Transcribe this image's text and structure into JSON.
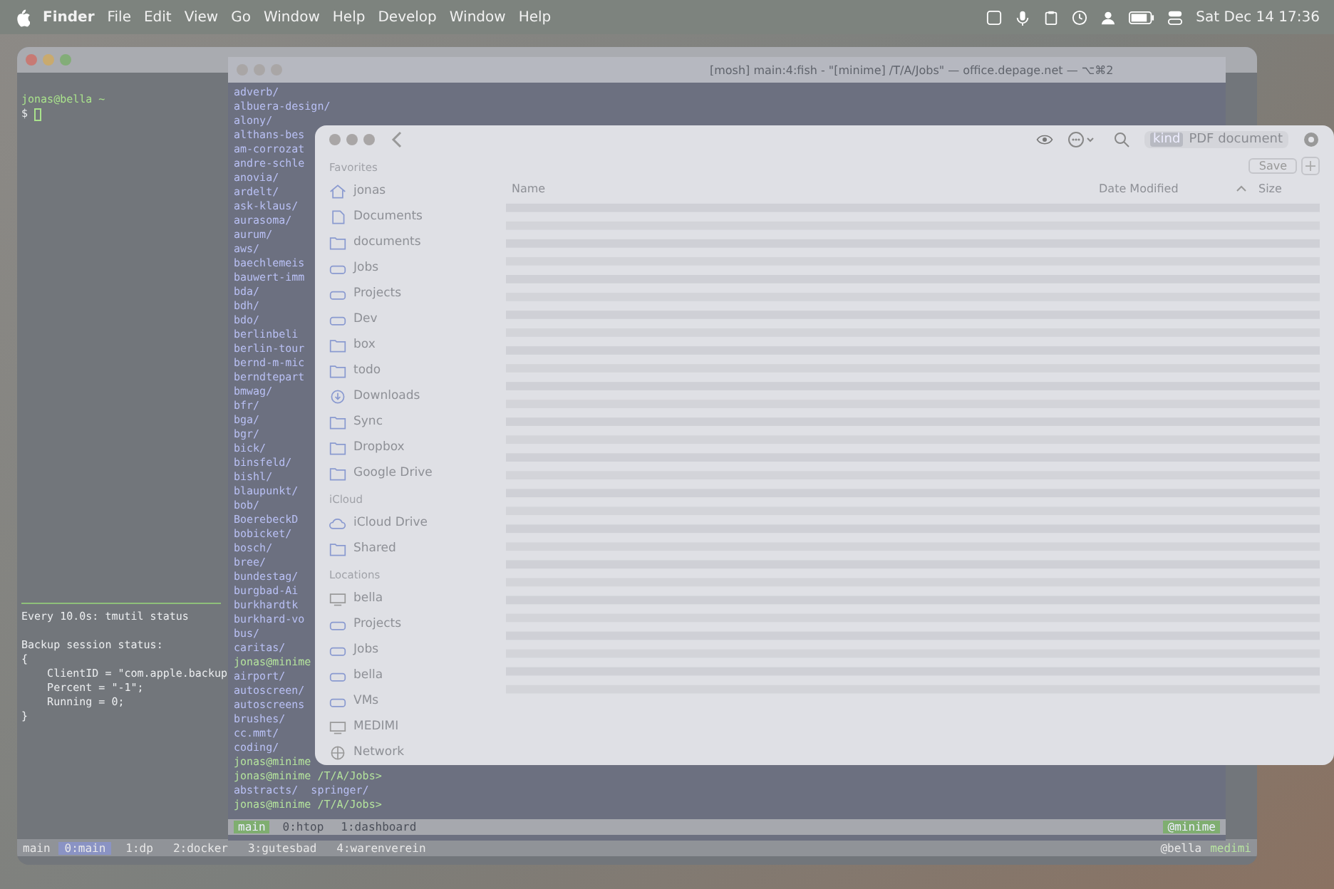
{
  "menu_bar": {
    "app": "Finder",
    "menus": [
      "File",
      "Edit",
      "View",
      "Go",
      "Window",
      "Help",
      "Develop",
      "Window",
      "Help"
    ],
    "clock": "Sat Dec 14 17:36"
  },
  "terminal_left": {
    "prompt": "jonas@bella ~",
    "cursor_line": "$",
    "watch_header": "Every 10.0s: tmutil status",
    "output": [
      "Backup session status:",
      "{",
      "    ClientID = \"com.apple.backup",
      "    Percent = \"-1\";",
      "    Running = 0;",
      "}"
    ],
    "tmux": {
      "session": "main",
      "windows": [
        {
          "label": "0:main",
          "selected": true
        },
        {
          "label": "1:dp",
          "selected": false
        },
        {
          "label": "2:docker",
          "selected": false
        },
        {
          "label": "3:gutesbad",
          "selected": false
        },
        {
          "label": "4:warenverein",
          "selected": false
        }
      ],
      "status": [
        "@bella",
        "medimi"
      ]
    }
  },
  "terminal_mid": {
    "title": "[mosh] main:4:fish - \"[minime] /T/A/Jobs\" — office.depage.net — ⌥⌘2",
    "lines": [
      {
        "kind": "dir",
        "text": "adverb/"
      },
      {
        "kind": "dir",
        "text": "albuera-design/"
      },
      {
        "kind": "dir",
        "text": "alony/"
      },
      {
        "kind": "dir",
        "text": "althans-bes"
      },
      {
        "kind": "dir",
        "text": "am-corrozat"
      },
      {
        "kind": "dir",
        "text": "andre-schle"
      },
      {
        "kind": "dir",
        "text": "anovia/"
      },
      {
        "kind": "dir",
        "text": "ardelt/"
      },
      {
        "kind": "dir",
        "text": "ask-klaus/"
      },
      {
        "kind": "dir",
        "text": "aurasoma/"
      },
      {
        "kind": "dir",
        "text": "aurum/"
      },
      {
        "kind": "dir",
        "text": "aws/"
      },
      {
        "kind": "dir",
        "text": "baechlemeis"
      },
      {
        "kind": "dir",
        "text": "bauwert-imm"
      },
      {
        "kind": "dir",
        "text": "bda/"
      },
      {
        "kind": "dir",
        "text": "bdh/"
      },
      {
        "kind": "dir",
        "text": "bdo/"
      },
      {
        "kind": "dir",
        "text": "berlinbeli"
      },
      {
        "kind": "dir",
        "text": "berlin-tour"
      },
      {
        "kind": "dir",
        "text": "bernd-m-mic"
      },
      {
        "kind": "dir",
        "text": "berndtepart"
      },
      {
        "kind": "dir",
        "text": "bmwag/"
      },
      {
        "kind": "dir",
        "text": "bfr/"
      },
      {
        "kind": "dir",
        "text": "bga/"
      },
      {
        "kind": "dir",
        "text": "bgr/"
      },
      {
        "kind": "dir",
        "text": "bick/"
      },
      {
        "kind": "dir",
        "text": "binsfeld/"
      },
      {
        "kind": "dir",
        "text": "bishl/"
      },
      {
        "kind": "dir",
        "text": "blaupunkt/"
      },
      {
        "kind": "dir",
        "text": "bob/"
      },
      {
        "kind": "dir",
        "text": "BoerebeckD"
      },
      {
        "kind": "dir",
        "text": "bobicket/"
      },
      {
        "kind": "dir",
        "text": "bosch/"
      },
      {
        "kind": "dir",
        "text": "bree/"
      },
      {
        "kind": "dir",
        "text": "bundestag/"
      },
      {
        "kind": "dir",
        "text": "burgbad-Ai"
      },
      {
        "kind": "dir",
        "text": "burkhardtk"
      },
      {
        "kind": "dir",
        "text": "burkhard-vo"
      },
      {
        "kind": "dir",
        "text": "bus/"
      },
      {
        "kind": "dir",
        "text": "caritas/"
      },
      {
        "kind": "prompt",
        "text": "jonas@minime"
      },
      {
        "kind": "dir",
        "text": "airport/"
      },
      {
        "kind": "dir",
        "text": "autoscreen/"
      },
      {
        "kind": "dir",
        "text": "autoscreens"
      },
      {
        "kind": "dir",
        "text": "brushes/"
      },
      {
        "kind": "dir",
        "text": "cc.mmt/"
      },
      {
        "kind": "dir",
        "text": "coding/"
      },
      {
        "kind": "prompt",
        "text": "jonas@minime"
      },
      {
        "kind": "prompt",
        "text": "jonas@minime /T/A/Jobs>"
      },
      {
        "kind": "dir",
        "text": "abstracts/  springer/"
      },
      {
        "kind": "prompt",
        "text": "jonas@minime /T/A/Jobs>"
      }
    ],
    "tmux": {
      "session": "main",
      "windows": [
        {
          "label": "0:htop",
          "selected": false
        },
        {
          "label": "1:dashboard",
          "selected": false
        }
      ],
      "host": "@minime"
    }
  },
  "finder": {
    "search": {
      "token": "kind",
      "value": "PDF document"
    },
    "save_button": "Save",
    "columns": [
      "Name",
      "Date Modified",
      "Size"
    ],
    "sidebar": [
      {
        "heading": "Favorites",
        "items": [
          {
            "kind": "home",
            "label": "jonas"
          },
          {
            "kind": "doc",
            "label": "Documents"
          },
          {
            "kind": "folder",
            "label": "documents"
          },
          {
            "kind": "drive",
            "label": "Jobs"
          },
          {
            "kind": "drive",
            "label": "Projects"
          },
          {
            "kind": "drive",
            "label": "Dev"
          },
          {
            "kind": "folder",
            "label": "box"
          },
          {
            "kind": "folder",
            "label": "todo"
          },
          {
            "kind": "download",
            "label": "Downloads"
          },
          {
            "kind": "folder",
            "label": "Sync"
          },
          {
            "kind": "folder",
            "label": "Dropbox"
          },
          {
            "kind": "folder",
            "label": "Google Drive"
          }
        ]
      },
      {
        "heading": "iCloud",
        "items": [
          {
            "kind": "cloud",
            "label": "iCloud Drive"
          },
          {
            "kind": "shared",
            "label": "Shared"
          }
        ]
      },
      {
        "heading": "Locations",
        "items": [
          {
            "kind": "computer",
            "label": "bella"
          },
          {
            "kind": "drive",
            "label": "Projects"
          },
          {
            "kind": "drive",
            "label": "Jobs"
          },
          {
            "kind": "drive",
            "label": "bella"
          },
          {
            "kind": "drive",
            "label": "VMs"
          },
          {
            "kind": "display",
            "label": "MEDIMI"
          },
          {
            "kind": "network",
            "label": "Network"
          }
        ]
      }
    ]
  }
}
